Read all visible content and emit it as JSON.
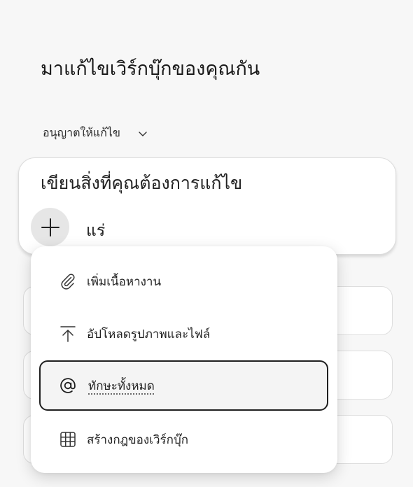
{
  "header": {
    "title": "มาแก้ไขเวิร์กบุ๊กของคุณกัน"
  },
  "permission": {
    "label": "อนุญาตให้แก้ไข"
  },
  "composer": {
    "placeholder": "เขียนสิ่งที่คุณต้องการแก้ไข",
    "typed_text": "แร่"
  },
  "menu": {
    "items": [
      {
        "label": "เพิ่มเนื้อหางาน",
        "icon": "paperclip-icon"
      },
      {
        "label": "อัปโหลดรูปภาพและไฟล์",
        "icon": "upload-icon"
      },
      {
        "label": "ทักษะทั้งหมด",
        "icon": "at-sign-icon",
        "selected": true
      },
      {
        "label": "สร้างกฎของเวิร์กบุ๊ก",
        "icon": "table-grid-icon"
      }
    ]
  }
}
